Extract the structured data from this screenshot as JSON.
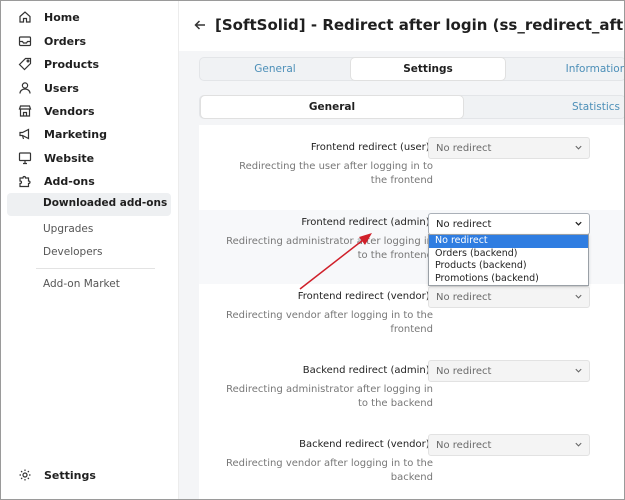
{
  "sidebar": {
    "items": [
      {
        "label": "Home",
        "icon": "home-icon"
      },
      {
        "label": "Orders",
        "icon": "inbox-icon"
      },
      {
        "label": "Products",
        "icon": "tag-icon"
      },
      {
        "label": "Users",
        "icon": "user-icon"
      },
      {
        "label": "Vendors",
        "icon": "store-icon"
      },
      {
        "label": "Marketing",
        "icon": "megaphone-icon"
      },
      {
        "label": "Website",
        "icon": "monitor-icon"
      },
      {
        "label": "Add-ons",
        "icon": "puzzle-icon"
      }
    ],
    "addons_sub": [
      "Downloaded add-ons",
      "Upgrades",
      "Developers"
    ],
    "market": "Add-on Market",
    "settings": {
      "label": "Settings",
      "icon": "gear-icon"
    }
  },
  "header": {
    "title": "[SoftSolid] - Redirect after login (ss_redirect_after)"
  },
  "tabs_top": [
    "General",
    "Settings",
    "Information"
  ],
  "tabs_inner": [
    "General",
    "Statistics"
  ],
  "rows": [
    {
      "label": "Frontend redirect (user):",
      "desc": "Redirecting the user after logging in to the frontend",
      "value": "No redirect"
    },
    {
      "label": "Frontend redirect (admin):",
      "desc": "Redirecting administrator after logging in to the frontend",
      "value": "No redirect"
    },
    {
      "label": "Frontend redirect (vendor):",
      "desc": "Redirecting vendor after logging in to the frontend",
      "value": "No redirect"
    },
    {
      "label": "Backend redirect (admin):",
      "desc": "Redirecting administrator after logging in to the backend",
      "value": "No redirect"
    },
    {
      "label": "Backend redirect (vendor):",
      "desc": "Redirecting vendor after logging in to the backend",
      "value": "No redirect"
    }
  ],
  "dropdown_options": [
    "No redirect",
    "Orders (backend)",
    "Products (backend)",
    "Promotions (backend)"
  ],
  "colors": {
    "link": "#4c8fb8",
    "selected_option": "#2f7de1",
    "annotation_arrow": "#d0202a"
  }
}
